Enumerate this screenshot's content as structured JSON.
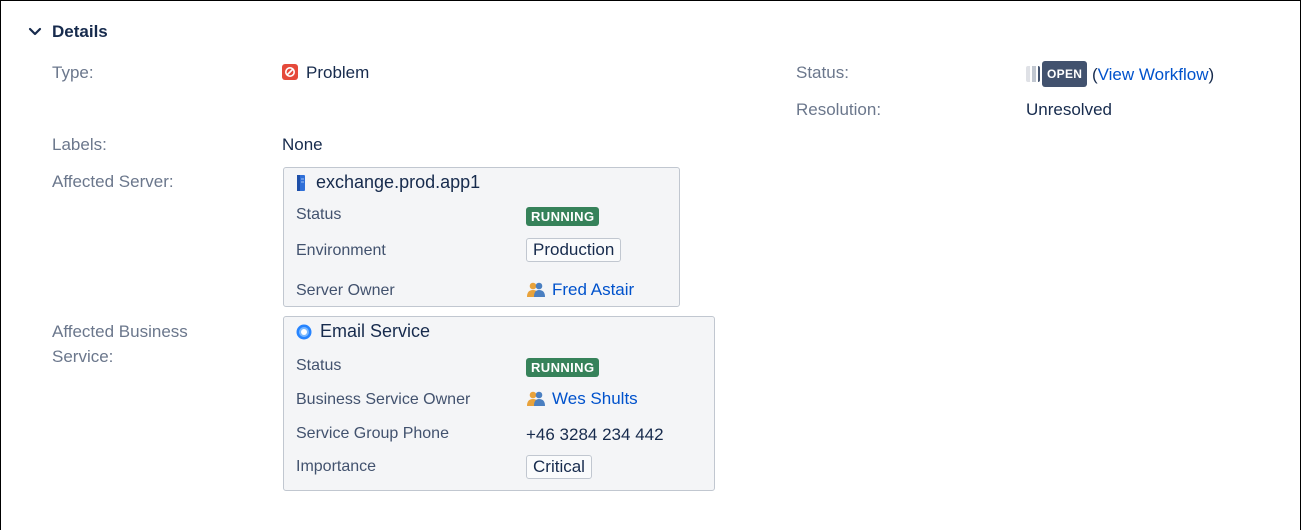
{
  "section": {
    "title": "Details"
  },
  "fields": {
    "type_label": "Type:",
    "type_value": "Problem",
    "status_label": "Status:",
    "status_lozenge": "OPEN",
    "workflow_link": "View Workflow",
    "paren_open": "(",
    "paren_close": ")",
    "resolution_label": "Resolution:",
    "resolution_value": "Unresolved",
    "labels_label": "Labels:",
    "labels_value": "None",
    "affected_server_label": "Affected Server:",
    "affected_service_label_1": "Affected Business",
    "affected_service_label_2": "Service:"
  },
  "server_card": {
    "title": "exchange.prod.app1",
    "rows": [
      {
        "label": "Status",
        "value": "RUNNING"
      },
      {
        "label": "Environment",
        "value": "Production"
      },
      {
        "label": "Server Owner",
        "value": "Fred Astair"
      }
    ]
  },
  "service_card": {
    "title": "Email Service",
    "rows": [
      {
        "label": "Status",
        "value": "RUNNING"
      },
      {
        "label": "Business Service Owner",
        "value": "Wes Shults"
      },
      {
        "label": "Service Group Phone",
        "value": "+46 3284 234 442"
      },
      {
        "label": "Importance",
        "value": "Critical"
      }
    ]
  },
  "colors": {
    "problem": "#e5493a",
    "running": "#36825a",
    "open": "#42526e",
    "link": "#0052cc"
  }
}
